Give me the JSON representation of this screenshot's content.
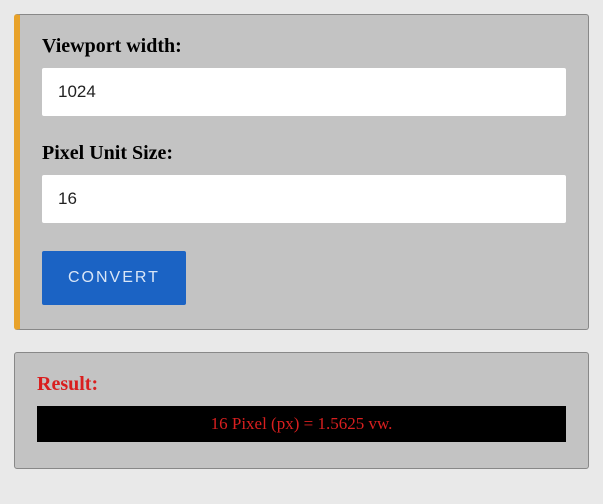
{
  "form": {
    "viewport_label": "Viewport width:",
    "viewport_value": "1024",
    "pixel_label": "Pixel Unit Size:",
    "pixel_value": "16",
    "convert_label": "CONVERT"
  },
  "result": {
    "heading": "Result:",
    "text": "16 Pixel (px) = 1.5625 vw."
  }
}
